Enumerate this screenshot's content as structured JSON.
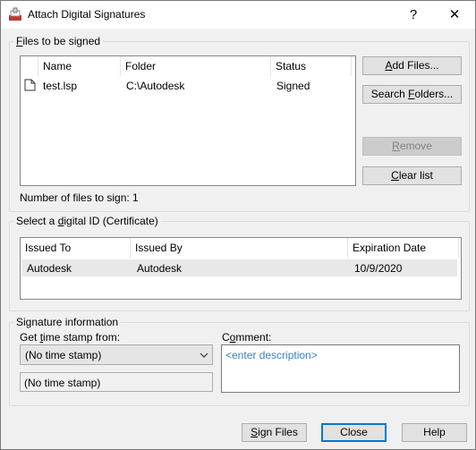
{
  "window": {
    "title": "Attach Digital Signatures",
    "help_glyph": "?",
    "close_glyph": "✕"
  },
  "files_group": {
    "label_pre": "",
    "label_ul": "F",
    "label_post": "iles to be signed",
    "columns": [
      "Name",
      "Folder",
      "Status"
    ],
    "rows": [
      {
        "name": "test.lsp",
        "folder": "C:\\Autodesk",
        "status": "Signed"
      }
    ],
    "count_text": "Number of files to sign: 1",
    "buttons": {
      "add_pre": "",
      "add_ul": "A",
      "add_post": "dd Files...",
      "search_pre": "Search ",
      "search_ul": "F",
      "search_post": "olders...",
      "remove_pre": "",
      "remove_ul": "R",
      "remove_post": "emove",
      "clear_pre": "",
      "clear_ul": "C",
      "clear_post": "lear list"
    }
  },
  "id_group": {
    "label_pre": "Select a ",
    "label_ul": "d",
    "label_post": "igital ID (Certificate)",
    "columns": [
      "Issued To",
      "Issued By",
      "Expiration Date"
    ],
    "rows": [
      {
        "issued_to": "Autodesk",
        "issued_by": "Autodesk",
        "expiration": "10/9/2020"
      }
    ]
  },
  "sig_group": {
    "label": "Signature information",
    "timestamp_label_pre": "Get ",
    "timestamp_label_ul": "t",
    "timestamp_label_post": "ime stamp from:",
    "timestamp_value": "(No time stamp)",
    "timestamp_readonly": "(No time stamp)",
    "comment_label_pre": "C",
    "comment_label_ul": "o",
    "comment_label_post": "mment:",
    "comment_placeholder": "<enter description>"
  },
  "footer": {
    "sign_pre": "",
    "sign_ul": "S",
    "sign_post": "ign Files",
    "close": "Close",
    "help": "Help"
  },
  "colors": {
    "accent": "#0078d7",
    "placeholder": "#3a7fc3",
    "selected_row": "#e8e8e8"
  }
}
